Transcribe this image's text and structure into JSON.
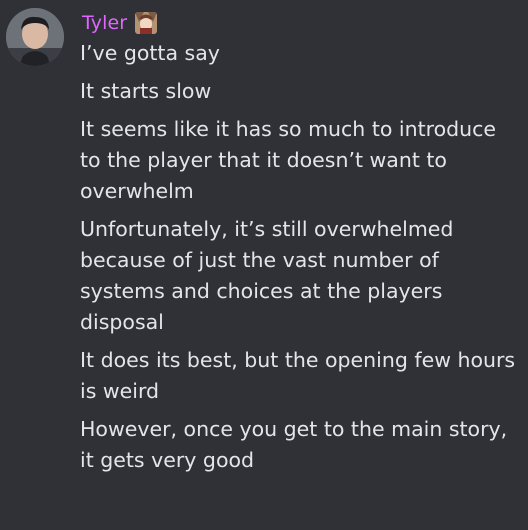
{
  "author": {
    "name": "Tyler",
    "color": "#e066ff",
    "avatar_icon": "user-avatar",
    "role_icon": "character-portrait-icon"
  },
  "messages": [
    "I’ve gotta say",
    "It starts slow",
    "It seems like it has so much to introduce to the player that it doesn’t want to overwhelm",
    "Unfortunately, it’s still overwhelmed because of just the vast number of systems and choices at the players disposal",
    "It does its best, but the opening few hours is weird",
    "However, once you get to the main story, it gets very good"
  ]
}
